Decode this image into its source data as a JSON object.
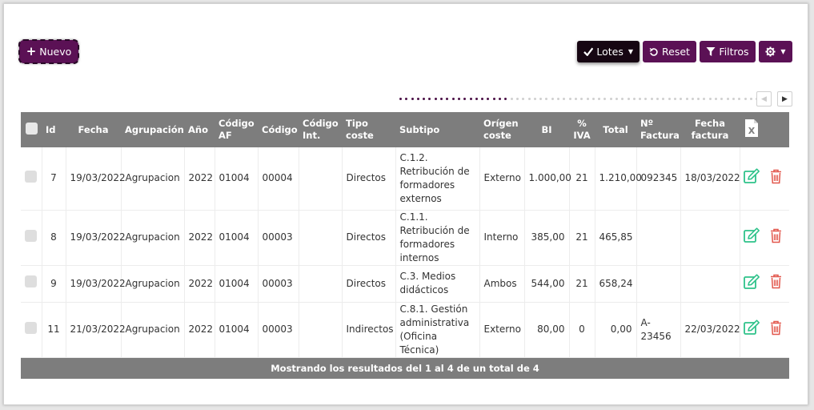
{
  "toolbar": {
    "nuevo_label": "Nuevo",
    "lotes_label": "Lotes",
    "reset_label": "Reset",
    "filtros_label": "Filtros"
  },
  "pager": {
    "active_dots": 19,
    "total_dots": 62
  },
  "table": {
    "headers": {
      "id": "Id",
      "fecha": "Fecha",
      "agrupacion": "Agrupación",
      "anio": "Año",
      "codigo_af": "Código AF",
      "codigo": "Código",
      "codigo_int": "Código Int.",
      "tipo_coste": "Tipo coste",
      "subtipo": "Subtipo",
      "origen_coste": "Orígen coste",
      "bi": "BI",
      "iva": "% IVA",
      "total": "Total",
      "num_factura": "Nº Factura",
      "fecha_factura": "Fecha factura"
    },
    "rows": [
      {
        "id": "7",
        "fecha": "19/03/2022",
        "agrupacion": "Agrupacion",
        "anio": "2022",
        "codigo_af": "01004",
        "codigo": "00004",
        "codigo_int": "",
        "tipo_coste": "Directos",
        "subtipo": "C.1.2. Retribución de formadores externos",
        "origen_coste": "Externo",
        "bi": "1.000,00",
        "iva": "21",
        "total": "1.210,00",
        "num_factura": "092345",
        "fecha_factura": "18/03/2022"
      },
      {
        "id": "8",
        "fecha": "19/03/2022",
        "agrupacion": "Agrupacion",
        "anio": "2022",
        "codigo_af": "01004",
        "codigo": "00003",
        "codigo_int": "",
        "tipo_coste": "Directos",
        "subtipo": "C.1.1. Retribución de formadores internos",
        "origen_coste": "Interno",
        "bi": "385,00",
        "iva": "21",
        "total": "465,85",
        "num_factura": "",
        "fecha_factura": ""
      },
      {
        "id": "9",
        "fecha": "19/03/2022",
        "agrupacion": "Agrupacion",
        "anio": "2022",
        "codigo_af": "01004",
        "codigo": "00003",
        "codigo_int": "",
        "tipo_coste": "Directos",
        "subtipo": "C.3. Medios didácticos",
        "origen_coste": "Ambos",
        "bi": "544,00",
        "iva": "21",
        "total": "658,24",
        "num_factura": "",
        "fecha_factura": ""
      },
      {
        "id": "11",
        "fecha": "21/03/2022",
        "agrupacion": "Agrupacion",
        "anio": "2022",
        "codigo_af": "01004",
        "codigo": "00003",
        "codigo_int": "",
        "tipo_coste": "Indirectos",
        "subtipo": "C.8.1. Gestión administrativa (Oficina Técnica)",
        "origen_coste": "Externo",
        "bi": "80,00",
        "iva": "0",
        "total": "0,00",
        "num_factura": "A-23456",
        "fecha_factura": "22/03/2022"
      }
    ],
    "footer": "Mostrando los resultados del 1 al 4 de un total de 4"
  },
  "colors": {
    "primary": "#5b1155",
    "dark_button": "#160612",
    "header_gray": "#7d7d7d",
    "edit_green": "#2ec28a",
    "delete_red": "#e2574c",
    "dot_active": "#4a0f46",
    "dot_inactive": "#cfcfcf"
  },
  "icons": {
    "nuevo": "plus-icon",
    "lotes": "check-icon",
    "reset": "undo-icon",
    "filtros": "filter-icon",
    "settings": "gear-icon",
    "excel": "excel-icon",
    "edit": "edit-icon",
    "delete": "trash-icon"
  }
}
